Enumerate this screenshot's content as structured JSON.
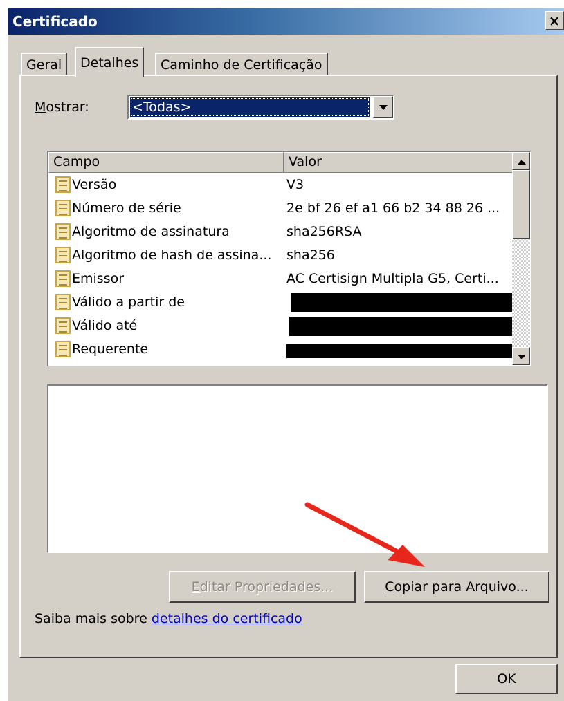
{
  "window": {
    "title": "Certificado",
    "close_glyph": "×"
  },
  "tabs": [
    {
      "label": "Geral",
      "active": false
    },
    {
      "label": "Detalhes",
      "active": true
    },
    {
      "label": "Caminho de Certificação",
      "active": false
    }
  ],
  "show": {
    "label": "Mostrar:",
    "selected": "<Todas>"
  },
  "fields_list": {
    "columns": [
      "Campo",
      "Valor"
    ],
    "rows": [
      {
        "field": "Versão",
        "value": "V3"
      },
      {
        "field": "Número de série",
        "value": "2e bf 26 ef a1 66 b2 34 88 26 ..."
      },
      {
        "field": "Algoritmo de assinatura",
        "value": "sha256RSA"
      },
      {
        "field": "Algoritmo de hash de assina...",
        "value": "sha256"
      },
      {
        "field": "Emissor",
        "value": "AC Certisign Multipla G5, Certi..."
      },
      {
        "field": "Válido a partir de",
        "value": ""
      },
      {
        "field": "Válido até",
        "value": ""
      },
      {
        "field": "Requerente",
        "value": ""
      }
    ],
    "icon": "certificate-field-icon"
  },
  "buttons": {
    "edit_properties": "Editar Propriedades...",
    "copy_to_file": "Copiar para Arquivo...",
    "ok": "OK"
  },
  "learn_more": {
    "prefix": "Saiba mais sobre ",
    "link": "detalhes do certificado"
  },
  "colors": {
    "dialog_bg": "#d4d0c8",
    "title_gradient_start": "#0a246a",
    "selection": "#0a246a",
    "link": "#0000cc",
    "annotation_arrow": "#e8271c"
  }
}
